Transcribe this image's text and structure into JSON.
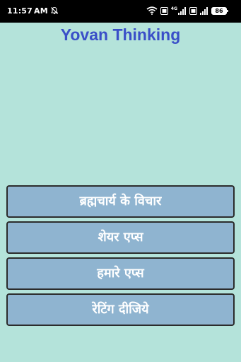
{
  "status_bar": {
    "time": "11:57",
    "ampm": "AM",
    "icons": [
      "mute-bell-icon",
      "wifi-icon",
      "volte-icon",
      "signal-4g-icon",
      "volte-icon",
      "signal-icon",
      "battery-icon"
    ],
    "network_label": "4G",
    "battery_level": "86"
  },
  "app": {
    "title": "Yovan Thinking"
  },
  "menu": {
    "items": [
      {
        "label": "ब्रह्मचार्य के विचार"
      },
      {
        "label": "शेयर एप्स"
      },
      {
        "label": "हमारे एप्स"
      },
      {
        "label": "रेटिंग दीजिये"
      }
    ]
  },
  "colors": {
    "background": "#b4e3da",
    "title": "#3a4fc8",
    "button_fill": "#8fb4d0",
    "button_border": "#2c2c2c",
    "status_bar": "#000000"
  }
}
